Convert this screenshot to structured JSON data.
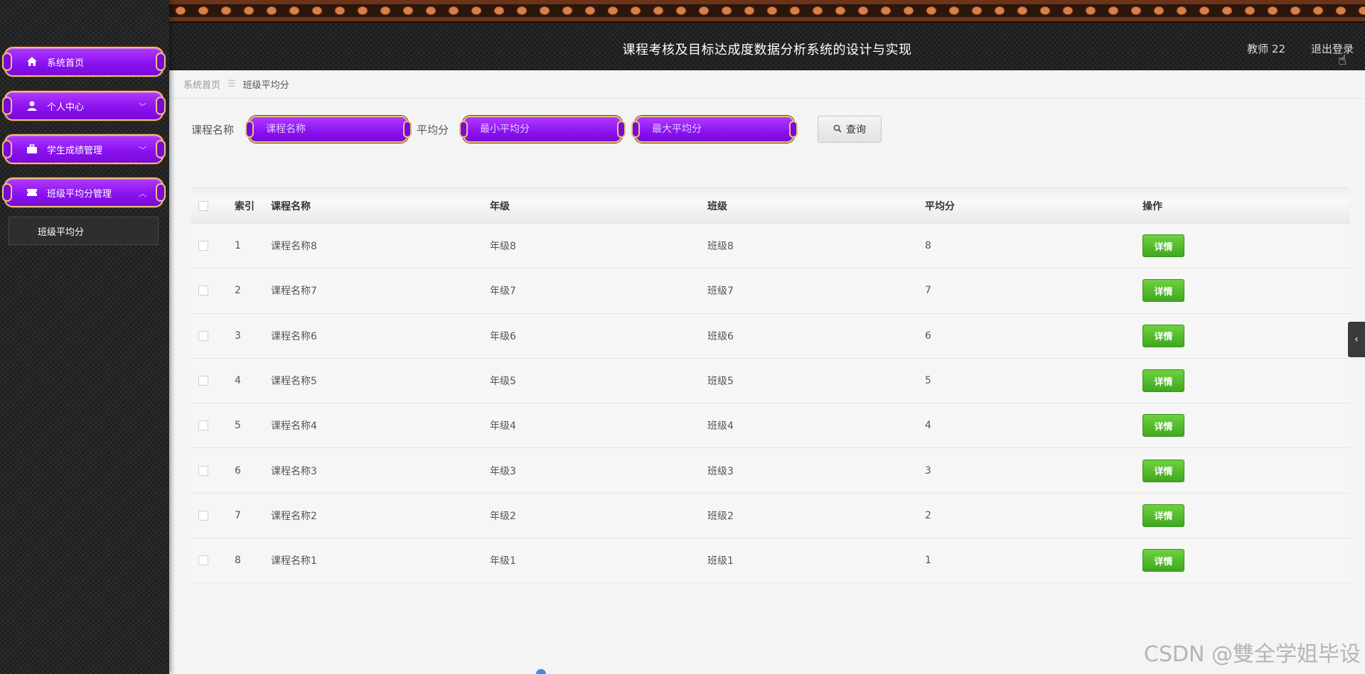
{
  "header": {
    "title": "课程考核及目标达成度数据分析系统的设计与实现",
    "user": "教师 22",
    "logout": "退出登录"
  },
  "sidebar": {
    "items": [
      {
        "label": "系统首页",
        "icon": "home-icon"
      },
      {
        "label": "个人中心",
        "icon": "user-icon"
      },
      {
        "label": "学生成绩管理",
        "icon": "briefcase-icon"
      },
      {
        "label": "班级平均分管理",
        "icon": "ticket-icon"
      }
    ],
    "sub_items": [
      {
        "label": "班级平均分"
      }
    ]
  },
  "breadcrumb": {
    "home": "系统首页",
    "separator": "☰",
    "current": "班级平均分"
  },
  "search": {
    "course_label": "课程名称",
    "course_placeholder": "课程名称",
    "avg_label": "平均分",
    "min_placeholder": "最小平均分",
    "max_placeholder": "最大平均分",
    "button": "查询"
  },
  "table": {
    "headers": {
      "index": "索引",
      "name": "课程名称",
      "grade": "年级",
      "class": "班级",
      "avg": "平均分",
      "op": "操作"
    },
    "rows": [
      {
        "index": "1",
        "name": "课程名称8",
        "grade": "年级8",
        "class": "班级8",
        "avg": "8",
        "action": "详情"
      },
      {
        "index": "2",
        "name": "课程名称7",
        "grade": "年级7",
        "class": "班级7",
        "avg": "7",
        "action": "详情"
      },
      {
        "index": "3",
        "name": "课程名称6",
        "grade": "年级6",
        "class": "班级6",
        "avg": "6",
        "action": "详情"
      },
      {
        "index": "4",
        "name": "课程名称5",
        "grade": "年级5",
        "class": "班级5",
        "avg": "5",
        "action": "详情"
      },
      {
        "index": "5",
        "name": "课程名称4",
        "grade": "年级4",
        "class": "班级4",
        "avg": "4",
        "action": "详情"
      },
      {
        "index": "6",
        "name": "课程名称3",
        "grade": "年级3",
        "class": "班级3",
        "avg": "3",
        "action": "详情"
      },
      {
        "index": "7",
        "name": "课程名称2",
        "grade": "年级2",
        "class": "班级2",
        "avg": "2",
        "action": "详情"
      },
      {
        "index": "8",
        "name": "课程名称1",
        "grade": "年级1",
        "class": "班级1",
        "avg": "1",
        "action": "详情"
      }
    ]
  },
  "watermark": "CSDN @雙全学姐毕设",
  "colors": {
    "menu_purple": "#8a12f0",
    "menu_border": "#e9c27a",
    "detail_green": "#4cb827"
  }
}
